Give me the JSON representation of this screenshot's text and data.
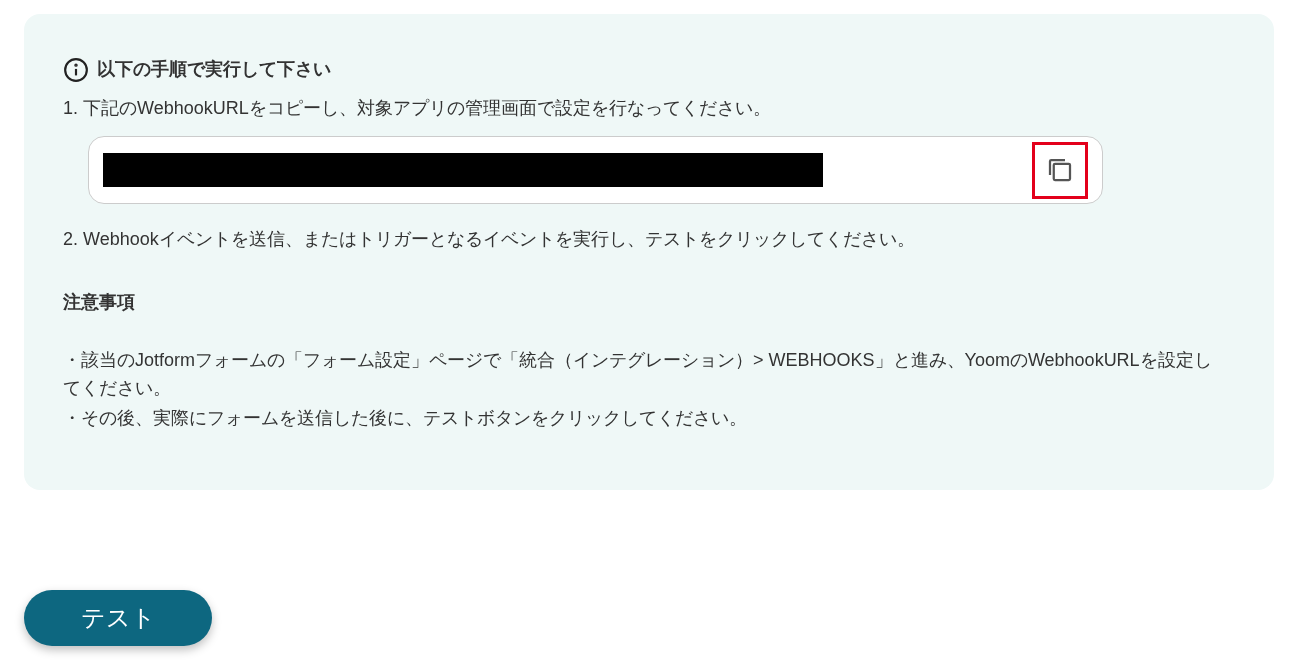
{
  "instructions": {
    "title": "以下の手順で実行して下さい",
    "step_1": "1. 下記のWebhookURLをコピーし、対象アプリの管理画面で設定を行なってください。",
    "url_field": {
      "redacted": true,
      "copy_highlighted": true
    },
    "step_2": "2. Webhookイベントを送信、またはトリガーとなるイベントを実行し、テストをクリックしてください。",
    "notes_heading": "注意事項",
    "notes": [
      "・該当のJotformフォームの「フォーム設定」ページで「統合（インテグレーション）> WEBHOOKS」と進み、YoomのWebhookURLを設定してください。",
      "・その後、実際にフォームを送信した後に、テストボタンをクリックしてください。"
    ]
  },
  "test_button": "テスト"
}
